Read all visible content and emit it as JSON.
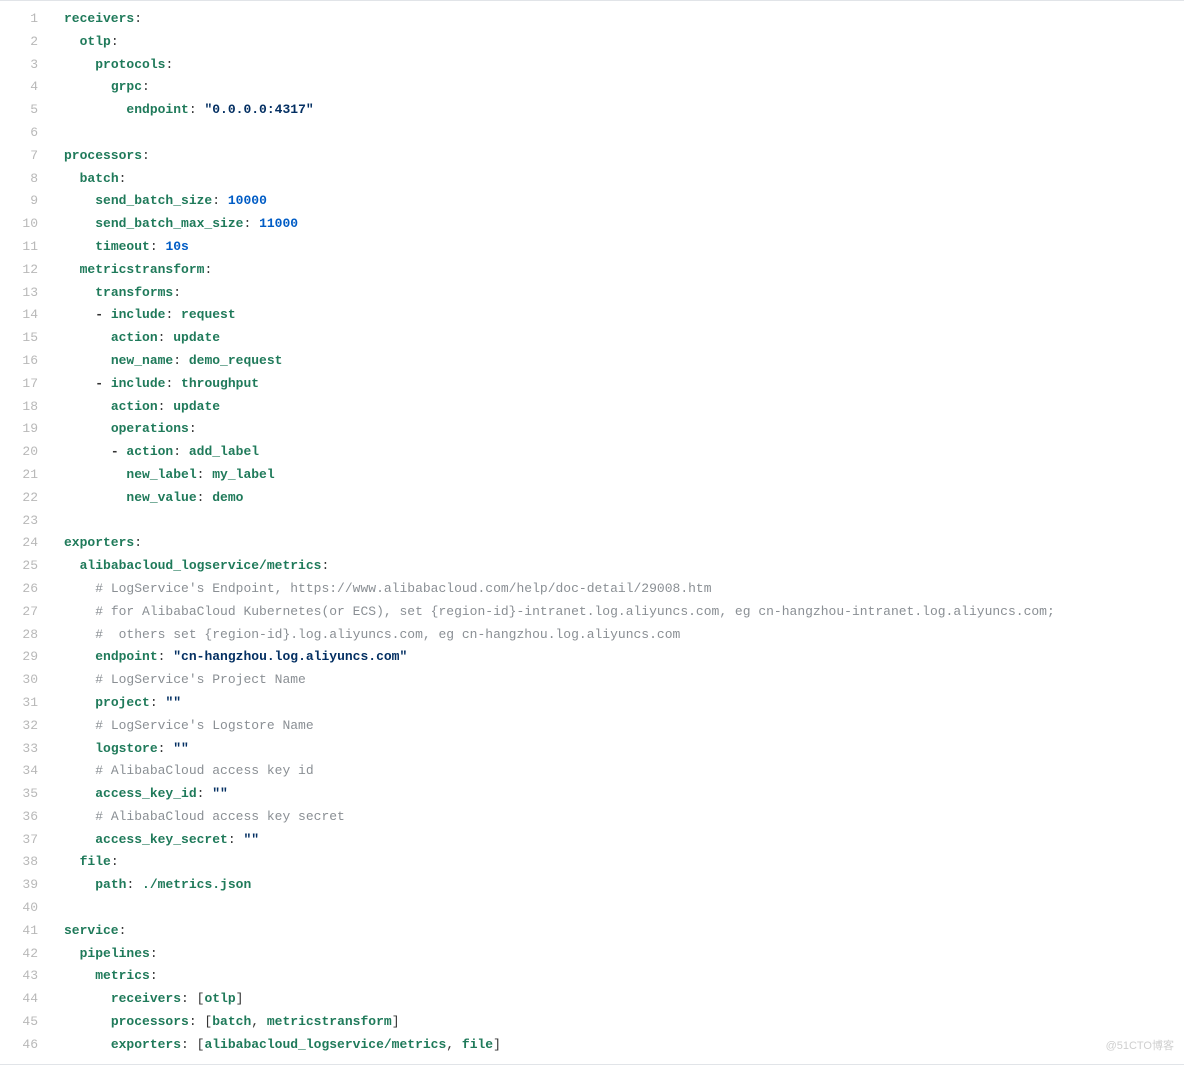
{
  "watermark": "@51CTO博客",
  "lines": [
    {
      "n": 1,
      "indent": 0,
      "tokens": [
        [
          "key",
          "receivers"
        ],
        [
          "p",
          ":"
        ]
      ]
    },
    {
      "n": 2,
      "indent": 1,
      "tokens": [
        [
          "key",
          "otlp"
        ],
        [
          "p",
          ":"
        ]
      ]
    },
    {
      "n": 3,
      "indent": 2,
      "tokens": [
        [
          "key",
          "protocols"
        ],
        [
          "p",
          ":"
        ]
      ]
    },
    {
      "n": 4,
      "indent": 3,
      "tokens": [
        [
          "key",
          "grpc"
        ],
        [
          "p",
          ":"
        ]
      ]
    },
    {
      "n": 5,
      "indent": 4,
      "tokens": [
        [
          "key",
          "endpoint"
        ],
        [
          "p",
          ": "
        ],
        [
          "str",
          "\"0.0.0.0:4317\""
        ]
      ]
    },
    {
      "n": 6,
      "indent": 0,
      "tokens": []
    },
    {
      "n": 7,
      "indent": 0,
      "tokens": [
        [
          "key",
          "processors"
        ],
        [
          "p",
          ":"
        ]
      ]
    },
    {
      "n": 8,
      "indent": 1,
      "tokens": [
        [
          "key",
          "batch"
        ],
        [
          "p",
          ":"
        ]
      ]
    },
    {
      "n": 9,
      "indent": 2,
      "tokens": [
        [
          "key",
          "send_batch_size"
        ],
        [
          "p",
          ": "
        ],
        [
          "lit",
          "10000"
        ]
      ]
    },
    {
      "n": 10,
      "indent": 2,
      "tokens": [
        [
          "key",
          "send_batch_max_size"
        ],
        [
          "p",
          ": "
        ],
        [
          "lit",
          "11000"
        ]
      ]
    },
    {
      "n": 11,
      "indent": 2,
      "tokens": [
        [
          "key",
          "timeout"
        ],
        [
          "p",
          ": "
        ],
        [
          "lit",
          "10s"
        ]
      ]
    },
    {
      "n": 12,
      "indent": 1,
      "tokens": [
        [
          "key",
          "metricstransform"
        ],
        [
          "p",
          ":"
        ]
      ]
    },
    {
      "n": 13,
      "indent": 2,
      "tokens": [
        [
          "key",
          "transforms"
        ],
        [
          "p",
          ":"
        ]
      ]
    },
    {
      "n": 14,
      "indent": 2,
      "tokens": [
        [
          "dash",
          "- "
        ],
        [
          "key",
          "include"
        ],
        [
          "p",
          ": "
        ],
        [
          "plain",
          "request"
        ]
      ]
    },
    {
      "n": 15,
      "indent": 3,
      "tokens": [
        [
          "key",
          "action"
        ],
        [
          "p",
          ": "
        ],
        [
          "plain",
          "update"
        ]
      ]
    },
    {
      "n": 16,
      "indent": 3,
      "tokens": [
        [
          "key",
          "new_name"
        ],
        [
          "p",
          ": "
        ],
        [
          "plain",
          "demo_request"
        ]
      ]
    },
    {
      "n": 17,
      "indent": 2,
      "tokens": [
        [
          "dash",
          "- "
        ],
        [
          "key",
          "include"
        ],
        [
          "p",
          ": "
        ],
        [
          "plain",
          "throughput"
        ]
      ]
    },
    {
      "n": 18,
      "indent": 3,
      "tokens": [
        [
          "key",
          "action"
        ],
        [
          "p",
          ": "
        ],
        [
          "plain",
          "update"
        ]
      ]
    },
    {
      "n": 19,
      "indent": 3,
      "tokens": [
        [
          "key",
          "operations"
        ],
        [
          "p",
          ":"
        ]
      ]
    },
    {
      "n": 20,
      "indent": 3,
      "tokens": [
        [
          "dash",
          "- "
        ],
        [
          "key",
          "action"
        ],
        [
          "p",
          ": "
        ],
        [
          "plain",
          "add_label"
        ]
      ]
    },
    {
      "n": 21,
      "indent": 4,
      "tokens": [
        [
          "key",
          "new_label"
        ],
        [
          "p",
          ": "
        ],
        [
          "plain",
          "my_label"
        ]
      ]
    },
    {
      "n": 22,
      "indent": 4,
      "tokens": [
        [
          "key",
          "new_value"
        ],
        [
          "p",
          ": "
        ],
        [
          "plain",
          "demo"
        ]
      ]
    },
    {
      "n": 23,
      "indent": 0,
      "tokens": []
    },
    {
      "n": 24,
      "indent": 0,
      "tokens": [
        [
          "key",
          "exporters"
        ],
        [
          "p",
          ":"
        ]
      ]
    },
    {
      "n": 25,
      "indent": 1,
      "tokens": [
        [
          "key",
          "alibabacloud_logservice/metrics"
        ],
        [
          "p",
          ":"
        ]
      ]
    },
    {
      "n": 26,
      "indent": 2,
      "tokens": [
        [
          "com",
          "# LogService's Endpoint, https://www.alibabacloud.com/help/doc-detail/29008.htm"
        ]
      ]
    },
    {
      "n": 27,
      "indent": 2,
      "tokens": [
        [
          "com",
          "# for AlibabaCloud Kubernetes(or ECS), set {region-id}-intranet.log.aliyuncs.com, eg cn-hangzhou-intranet.log.aliyuncs.com;"
        ]
      ]
    },
    {
      "n": 28,
      "indent": 2,
      "tokens": [
        [
          "com",
          "#  others set {region-id}.log.aliyuncs.com, eg cn-hangzhou.log.aliyuncs.com"
        ]
      ]
    },
    {
      "n": 29,
      "indent": 2,
      "tokens": [
        [
          "key",
          "endpoint"
        ],
        [
          "p",
          ": "
        ],
        [
          "str",
          "\"cn-hangzhou.log.aliyuncs.com\""
        ]
      ]
    },
    {
      "n": 30,
      "indent": 2,
      "tokens": [
        [
          "com",
          "# LogService's Project Name"
        ]
      ]
    },
    {
      "n": 31,
      "indent": 2,
      "tokens": [
        [
          "key",
          "project"
        ],
        [
          "p",
          ": "
        ],
        [
          "str",
          "\"\""
        ]
      ]
    },
    {
      "n": 32,
      "indent": 2,
      "tokens": [
        [
          "com",
          "# LogService's Logstore Name"
        ]
      ]
    },
    {
      "n": 33,
      "indent": 2,
      "tokens": [
        [
          "key",
          "logstore"
        ],
        [
          "p",
          ": "
        ],
        [
          "str",
          "\"\""
        ]
      ]
    },
    {
      "n": 34,
      "indent": 2,
      "tokens": [
        [
          "com",
          "# AlibabaCloud access key id"
        ]
      ]
    },
    {
      "n": 35,
      "indent": 2,
      "tokens": [
        [
          "key",
          "access_key_id"
        ],
        [
          "p",
          ": "
        ],
        [
          "str",
          "\"\""
        ]
      ]
    },
    {
      "n": 36,
      "indent": 2,
      "tokens": [
        [
          "com",
          "# AlibabaCloud access key secret"
        ]
      ]
    },
    {
      "n": 37,
      "indent": 2,
      "tokens": [
        [
          "key",
          "access_key_secret"
        ],
        [
          "p",
          ": "
        ],
        [
          "str",
          "\"\""
        ]
      ]
    },
    {
      "n": 38,
      "indent": 1,
      "tokens": [
        [
          "key",
          "file"
        ],
        [
          "p",
          ":"
        ]
      ]
    },
    {
      "n": 39,
      "indent": 2,
      "tokens": [
        [
          "key",
          "path"
        ],
        [
          "p",
          ": "
        ],
        [
          "plain",
          "./metrics.json"
        ]
      ]
    },
    {
      "n": 40,
      "indent": 0,
      "tokens": []
    },
    {
      "n": 41,
      "indent": 0,
      "tokens": [
        [
          "key",
          "service"
        ],
        [
          "p",
          ":"
        ]
      ]
    },
    {
      "n": 42,
      "indent": 1,
      "tokens": [
        [
          "key",
          "pipelines"
        ],
        [
          "p",
          ":"
        ]
      ]
    },
    {
      "n": 43,
      "indent": 2,
      "tokens": [
        [
          "key",
          "metrics"
        ],
        [
          "p",
          ":"
        ]
      ]
    },
    {
      "n": 44,
      "indent": 3,
      "tokens": [
        [
          "key",
          "receivers"
        ],
        [
          "p",
          ": ["
        ],
        [
          "plain",
          "otlp"
        ],
        [
          "p",
          "]"
        ]
      ]
    },
    {
      "n": 45,
      "indent": 3,
      "tokens": [
        [
          "key",
          "processors"
        ],
        [
          "p",
          ": ["
        ],
        [
          "plain",
          "batch"
        ],
        [
          "p",
          ", "
        ],
        [
          "plain",
          "metricstransform"
        ],
        [
          "p",
          "]"
        ]
      ]
    },
    {
      "n": 46,
      "indent": 3,
      "tokens": [
        [
          "key",
          "exporters"
        ],
        [
          "p",
          ": ["
        ],
        [
          "plain",
          "alibabacloud_logservice/metrics"
        ],
        [
          "p",
          ", "
        ],
        [
          "plain",
          "file"
        ],
        [
          "p",
          "]"
        ]
      ]
    }
  ]
}
